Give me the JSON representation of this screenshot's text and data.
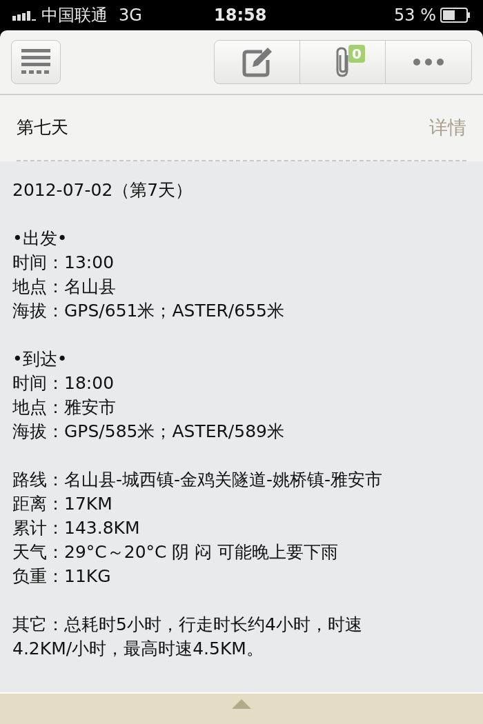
{
  "status_bar": {
    "carrier": "中国联通",
    "network": "3G",
    "time": "18:58",
    "battery": "53 %"
  },
  "toolbar": {
    "attachment_count": "0"
  },
  "note": {
    "title": "第七天",
    "details_link": "详情",
    "sections": [
      [
        "2012-07-02（第7天）"
      ],
      [
        "•出发•",
        "时间：13:00",
        "地点：名山县",
        "海拔：GPS/651米；ASTER/655米"
      ],
      [
        "•到达•",
        "时间：18:00",
        "地点：雅安市",
        "海拔：GPS/585米；ASTER/589米"
      ],
      [
        "路线：名山县-城西镇-金鸡关隧道-姚桥镇-雅安市",
        "距离：17KM",
        "累计：143.8KM",
        "天气：29°C～20°C 阴 闷 可能晚上要下雨",
        "负重：11KG"
      ],
      [
        "其它：总耗时5小时，行走时长约4小时，时速",
        "4.2KM/小时，最高时速4.5KM。"
      ]
    ]
  }
}
